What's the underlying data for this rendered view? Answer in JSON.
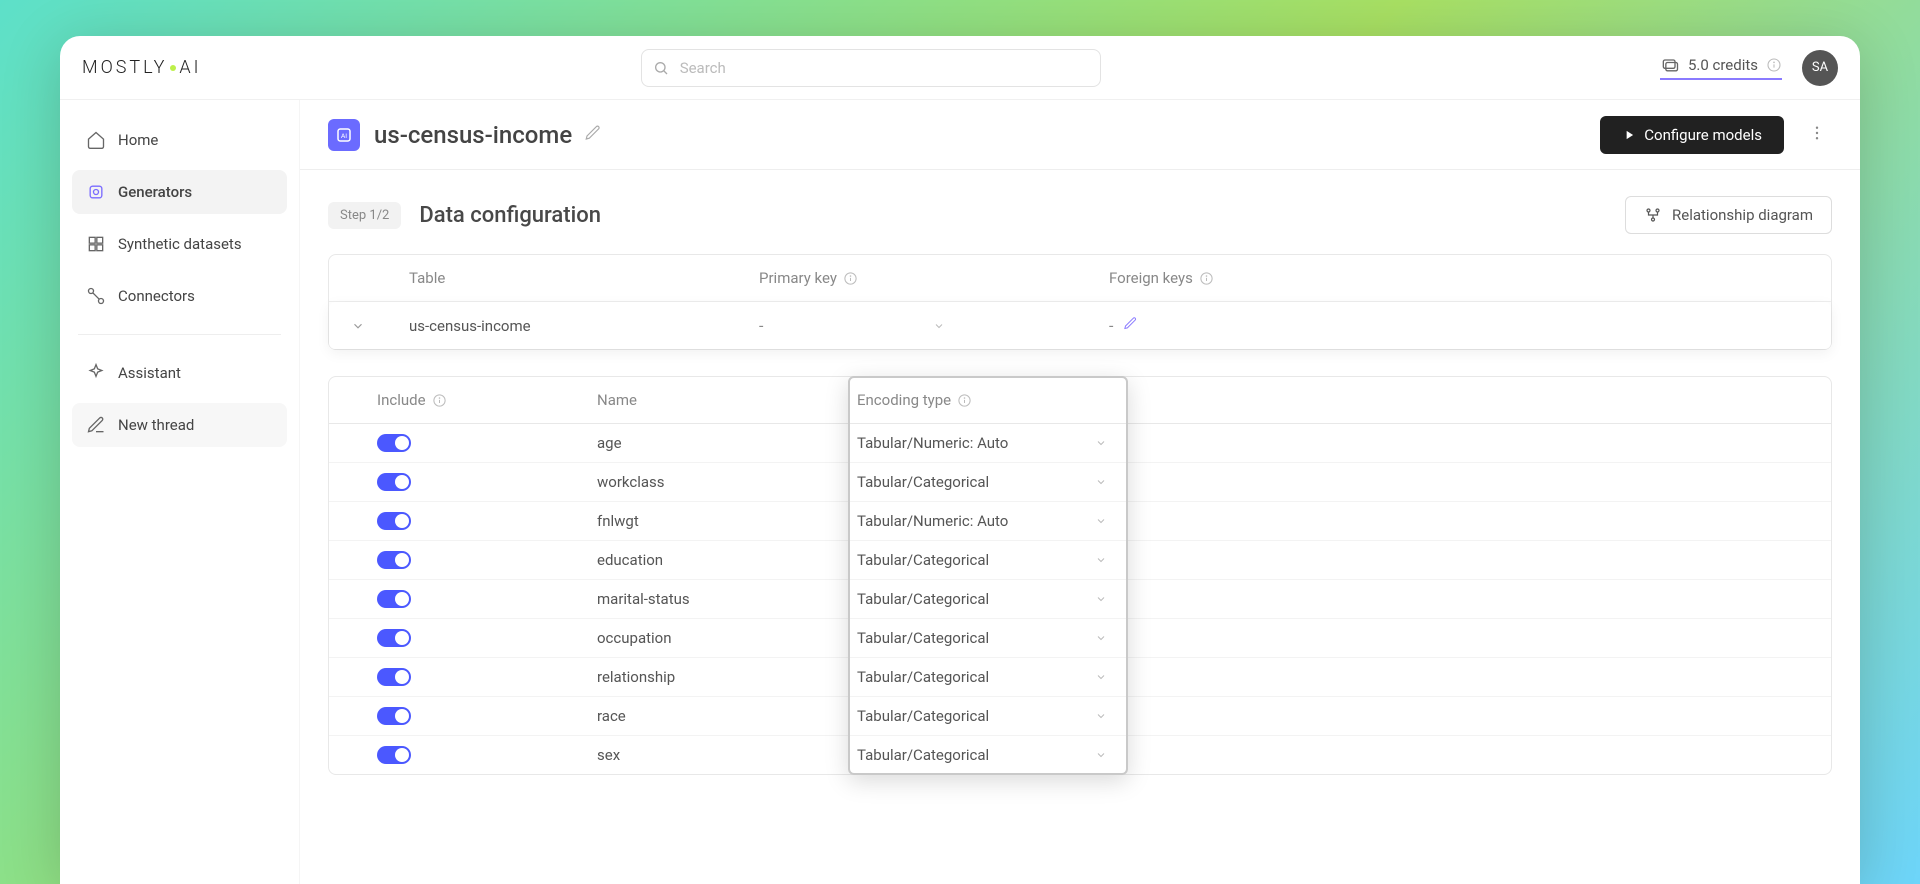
{
  "logo": {
    "part1": "MOSTLY",
    "part2": "AI"
  },
  "search": {
    "placeholder": "Search"
  },
  "credits": {
    "amount": "5.0 credits"
  },
  "avatar": {
    "initials": "SA"
  },
  "sidebar": {
    "home": "Home",
    "generators": "Generators",
    "synthetic": "Synthetic datasets",
    "connectors": "Connectors",
    "assistant": "Assistant",
    "newthread": "New thread"
  },
  "page": {
    "dataset": "us-census-income",
    "configure_btn": "Configure models"
  },
  "config": {
    "step": "Step 1/2",
    "title": "Data configuration",
    "rel_btn": "Relationship diagram"
  },
  "tables_header": {
    "table": "Table",
    "pk": "Primary key",
    "fk": "Foreign keys"
  },
  "table_row": {
    "name": "us-census-income",
    "pk": "-",
    "fk": "-"
  },
  "columns_header": {
    "include": "Include",
    "name": "Name",
    "encoding": "Encoding type"
  },
  "columns": [
    {
      "name": "age",
      "encoding": "Tabular/Numeric: Auto"
    },
    {
      "name": "workclass",
      "encoding": "Tabular/Categorical"
    },
    {
      "name": "fnlwgt",
      "encoding": "Tabular/Numeric: Auto"
    },
    {
      "name": "education",
      "encoding": "Tabular/Categorical"
    },
    {
      "name": "marital-status",
      "encoding": "Tabular/Categorical"
    },
    {
      "name": "occupation",
      "encoding": "Tabular/Categorical"
    },
    {
      "name": "relationship",
      "encoding": "Tabular/Categorical"
    },
    {
      "name": "race",
      "encoding": "Tabular/Categorical"
    },
    {
      "name": "sex",
      "encoding": "Tabular/Categorical"
    }
  ]
}
